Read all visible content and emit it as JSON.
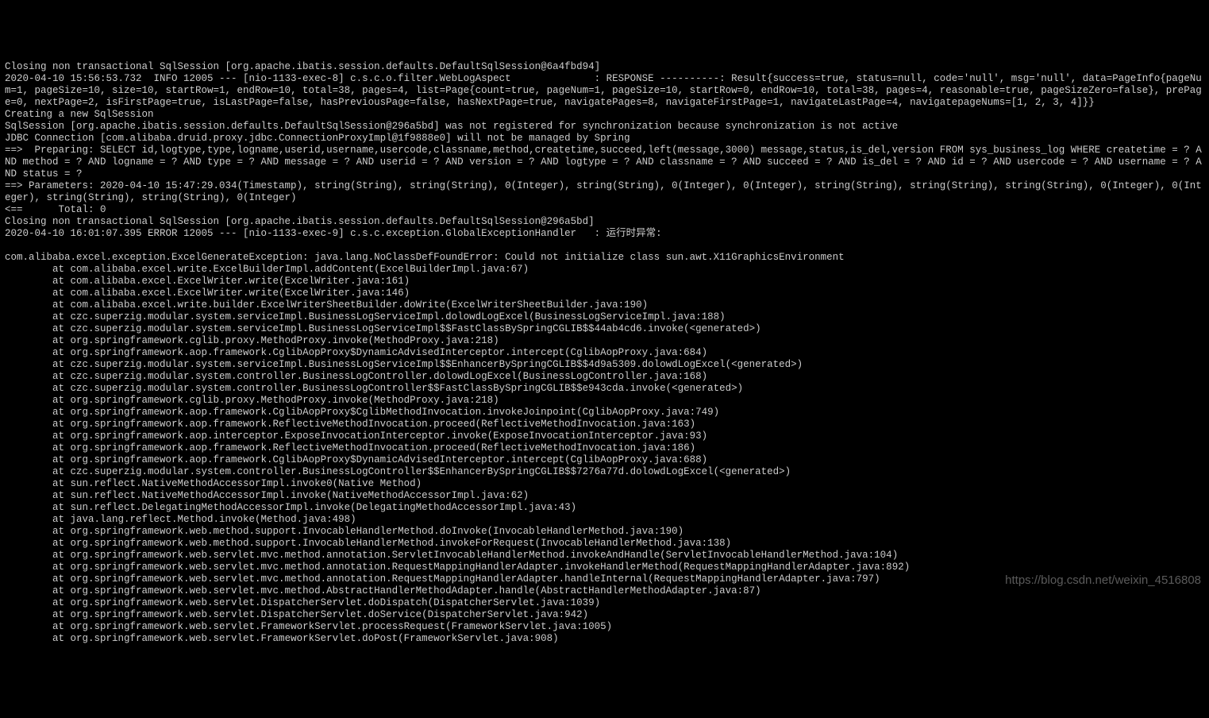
{
  "watermark": "https://blog.csdn.net/weixin_4516808",
  "lines": [
    "Closing non transactional SqlSession [org.apache.ibatis.session.defaults.DefaultSqlSession@6a4fbd94]",
    "2020-04-10 15:56:53.732  INFO 12005 --- [nio-1133-exec-8] c.s.c.o.filter.WebLogAspect              : RESPONSE ----------: Result{success=true, status=null, code='null', msg='null', data=PageInfo{pageNum=1, pageSize=10, size=10, startRow=1, endRow=10, total=38, pages=4, list=Page{count=true, pageNum=1, pageSize=10, startRow=0, endRow=10, total=38, pages=4, reasonable=true, pageSizeZero=false}, prePage=0, nextPage=2, isFirstPage=true, isLastPage=false, hasPreviousPage=false, hasNextPage=true, navigatePages=8, navigateFirstPage=1, navigateLastPage=4, navigatepageNums=[1, 2, 3, 4]}}",
    "Creating a new SqlSession",
    "SqlSession [org.apache.ibatis.session.defaults.DefaultSqlSession@296a5bd] was not registered for synchronization because synchronization is not active",
    "JDBC Connection [com.alibaba.druid.proxy.jdbc.ConnectionProxyImpl@1f9888e0] will not be managed by Spring",
    "==>  Preparing: SELECT id,logtype,type,logname,userid,username,usercode,classname,method,createtime,succeed,left(message,3000) message,status,is_del,version FROM sys_business_log WHERE createtime = ? AND method = ? AND logname = ? AND type = ? AND message = ? AND userid = ? AND version = ? AND logtype = ? AND classname = ? AND succeed = ? AND is_del = ? AND id = ? AND usercode = ? AND username = ? AND status = ?",
    "==> Parameters: 2020-04-10 15:47:29.034(Timestamp), string(String), string(String), 0(Integer), string(String), 0(Integer), 0(Integer), string(String), string(String), string(String), 0(Integer), 0(Integer), string(String), string(String), 0(Integer)",
    "<==      Total: 0",
    "Closing non transactional SqlSession [org.apache.ibatis.session.defaults.DefaultSqlSession@296a5bd]",
    "2020-04-10 16:01:07.395 ERROR 12005 --- [nio-1133-exec-9] c.s.c.exception.GlobalExceptionHandler   : 运行时异常:",
    "",
    "com.alibaba.excel.exception.ExcelGenerateException: java.lang.NoClassDefFoundError: Could not initialize class sun.awt.X11GraphicsEnvironment",
    "        at com.alibaba.excel.write.ExcelBuilderImpl.addContent(ExcelBuilderImpl.java:67)",
    "        at com.alibaba.excel.ExcelWriter.write(ExcelWriter.java:161)",
    "        at com.alibaba.excel.ExcelWriter.write(ExcelWriter.java:146)",
    "        at com.alibaba.excel.write.builder.ExcelWriterSheetBuilder.doWrite(ExcelWriterSheetBuilder.java:190)",
    "        at czc.superzig.modular.system.serviceImpl.BusinessLogServiceImpl.dolowdLogExcel(BusinessLogServiceImpl.java:188)",
    "        at czc.superzig.modular.system.serviceImpl.BusinessLogServiceImpl$$FastClassBySpringCGLIB$$44ab4cd6.invoke(<generated>)",
    "        at org.springframework.cglib.proxy.MethodProxy.invoke(MethodProxy.java:218)",
    "        at org.springframework.aop.framework.CglibAopProxy$DynamicAdvisedInterceptor.intercept(CglibAopProxy.java:684)",
    "        at czc.superzig.modular.system.serviceImpl.BusinessLogServiceImpl$$EnhancerBySpringCGLIB$$4d9a5309.dolowdLogExcel(<generated>)",
    "        at czc.superzig.modular.system.controller.BusinessLogController.dolowdLogExcel(BusinessLogController.java:168)",
    "        at czc.superzig.modular.system.controller.BusinessLogController$$FastClassBySpringCGLIB$$e943cda.invoke(<generated>)",
    "        at org.springframework.cglib.proxy.MethodProxy.invoke(MethodProxy.java:218)",
    "        at org.springframework.aop.framework.CglibAopProxy$CglibMethodInvocation.invokeJoinpoint(CglibAopProxy.java:749)",
    "        at org.springframework.aop.framework.ReflectiveMethodInvocation.proceed(ReflectiveMethodInvocation.java:163)",
    "        at org.springframework.aop.interceptor.ExposeInvocationInterceptor.invoke(ExposeInvocationInterceptor.java:93)",
    "        at org.springframework.aop.framework.ReflectiveMethodInvocation.proceed(ReflectiveMethodInvocation.java:186)",
    "        at org.springframework.aop.framework.CglibAopProxy$DynamicAdvisedInterceptor.intercept(CglibAopProxy.java:688)",
    "        at czc.superzig.modular.system.controller.BusinessLogController$$EnhancerBySpringCGLIB$$7276a77d.dolowdLogExcel(<generated>)",
    "        at sun.reflect.NativeMethodAccessorImpl.invoke0(Native Method)",
    "        at sun.reflect.NativeMethodAccessorImpl.invoke(NativeMethodAccessorImpl.java:62)",
    "        at sun.reflect.DelegatingMethodAccessorImpl.invoke(DelegatingMethodAccessorImpl.java:43)",
    "        at java.lang.reflect.Method.invoke(Method.java:498)",
    "        at org.springframework.web.method.support.InvocableHandlerMethod.doInvoke(InvocableHandlerMethod.java:190)",
    "        at org.springframework.web.method.support.InvocableHandlerMethod.invokeForRequest(InvocableHandlerMethod.java:138)",
    "        at org.springframework.web.servlet.mvc.method.annotation.ServletInvocableHandlerMethod.invokeAndHandle(ServletInvocableHandlerMethod.java:104)",
    "        at org.springframework.web.servlet.mvc.method.annotation.RequestMappingHandlerAdapter.invokeHandlerMethod(RequestMappingHandlerAdapter.java:892)",
    "        at org.springframework.web.servlet.mvc.method.annotation.RequestMappingHandlerAdapter.handleInternal(RequestMappingHandlerAdapter.java:797)",
    "        at org.springframework.web.servlet.mvc.method.AbstractHandlerMethodAdapter.handle(AbstractHandlerMethodAdapter.java:87)",
    "        at org.springframework.web.servlet.DispatcherServlet.doDispatch(DispatcherServlet.java:1039)",
    "        at org.springframework.web.servlet.DispatcherServlet.doService(DispatcherServlet.java:942)",
    "        at org.springframework.web.servlet.FrameworkServlet.processRequest(FrameworkServlet.java:1005)",
    "        at org.springframework.web.servlet.FrameworkServlet.doPost(FrameworkServlet.java:908)"
  ]
}
